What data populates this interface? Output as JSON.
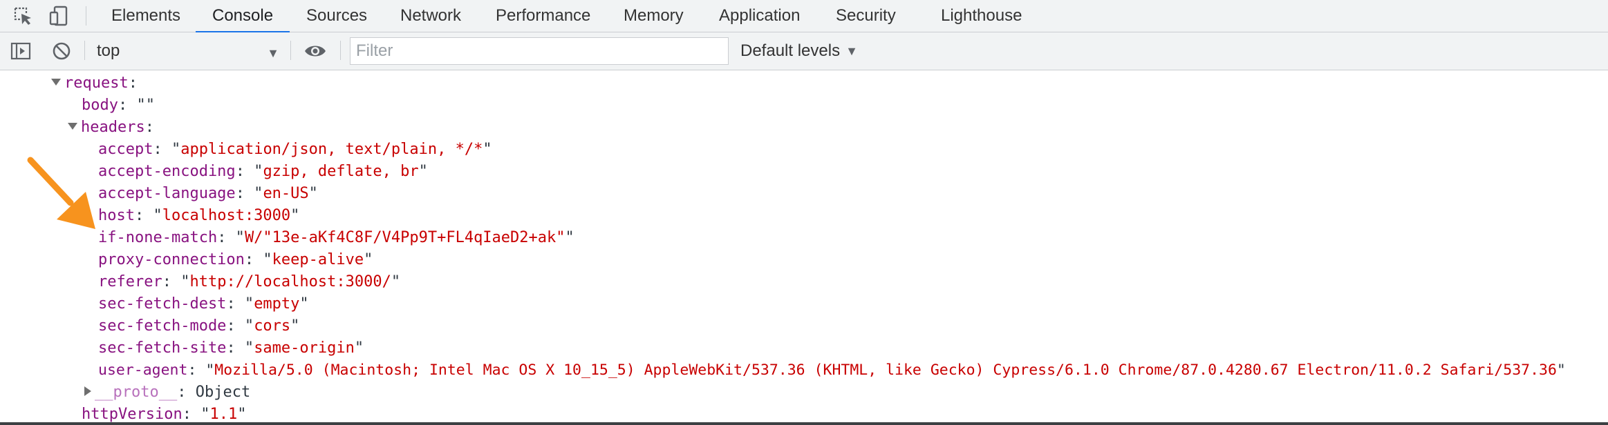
{
  "tabs": {
    "elements": "Elements",
    "console": "Console",
    "sources": "Sources",
    "network": "Network",
    "performance": "Performance",
    "memory": "Memory",
    "application": "Application",
    "security": "Security",
    "lighthouse": "Lighthouse"
  },
  "toolbar": {
    "context": "top",
    "filter_placeholder": "Filter",
    "levels": "Default levels"
  },
  "console": {
    "request": {
      "key": "request",
      "colon": ":"
    },
    "body": {
      "key": "body",
      "sep": ": ",
      "value": "\"\""
    },
    "headers": {
      "key": "headers",
      "colon": ":"
    },
    "accept": {
      "key": "accept",
      "value": "application/json, text/plain, */*"
    },
    "accept_encoding": {
      "key": "accept-encoding",
      "value": "gzip, deflate, br"
    },
    "accept_language": {
      "key": "accept-language",
      "value": "en-US"
    },
    "host": {
      "key": "host",
      "value": "localhost:3000"
    },
    "if_none_match": {
      "key": "if-none-match",
      "value": "W/\"13e-aKf4C8F/V4Pp9T+FL4qIaeD2+ak\""
    },
    "proxy_connection": {
      "key": "proxy-connection",
      "value": "keep-alive"
    },
    "referer": {
      "key": "referer",
      "value": "http://localhost:3000/"
    },
    "sec_fetch_dest": {
      "key": "sec-fetch-dest",
      "value": "empty"
    },
    "sec_fetch_mode": {
      "key": "sec-fetch-mode",
      "value": "cors"
    },
    "sec_fetch_site": {
      "key": "sec-fetch-site",
      "value": "same-origin"
    },
    "user_agent": {
      "key": "user-agent",
      "value": "Mozilla/5.0 (Macintosh; Intel Mac OS X 10_15_5) AppleWebKit/537.36 (KHTML, like Gecko) Cypress/6.1.0 Chrome/87.0.4280.67 Electron/11.0.2 Safari/537.36"
    },
    "proto": {
      "key": "__proto__",
      "value": "Object"
    },
    "http_version": {
      "key": "httpVersion",
      "value": "1.1"
    }
  },
  "colors": {
    "accent": "#1a73e8",
    "key": "#881280",
    "string": "#c80000",
    "annotation_arrow": "#f7931e"
  }
}
